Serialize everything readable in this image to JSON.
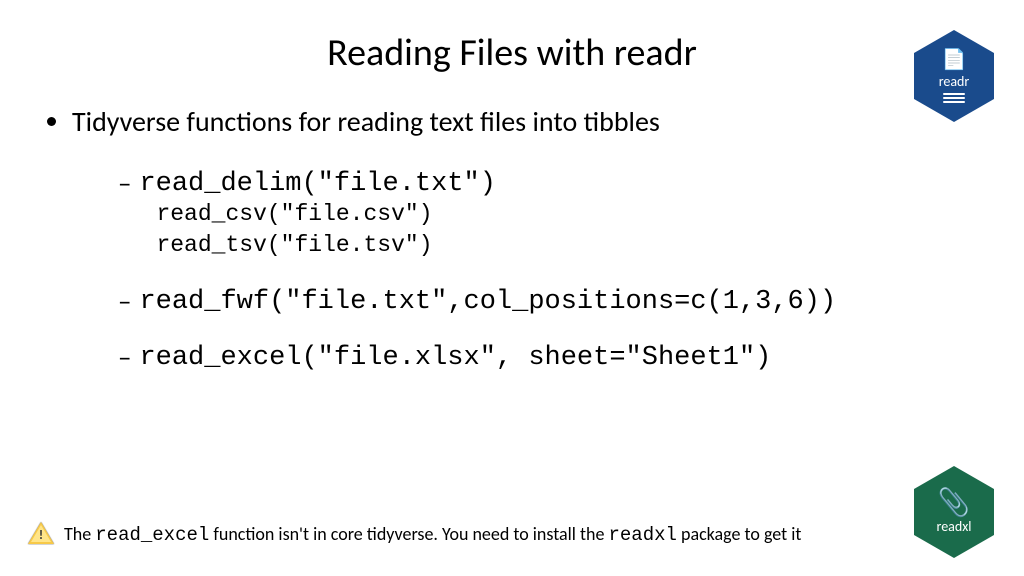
{
  "title": "Reading Files with readr",
  "logos": {
    "readr_label": "readr",
    "readxl_label": "readxl"
  },
  "main_bullet": "Tidyverse functions for reading text files into tibbles",
  "items": [
    {
      "main": "read_delim(\"file.txt\")",
      "subs": [
        "read_csv(\"file.csv\")",
        "read_tsv(\"file.tsv\")"
      ]
    },
    {
      "main": "read_fwf(\"file.txt\",col_positions=c(1,3,6))",
      "subs": []
    },
    {
      "main": "read_excel(\"file.xlsx\",  sheet=\"Sheet1\")",
      "subs": []
    }
  ],
  "footer": {
    "pre": "The ",
    "fn1": "read_excel",
    "mid": "  function isn't in core tidyverse. You need to install the ",
    "fn2": "readxl",
    "post": " package to get it"
  }
}
